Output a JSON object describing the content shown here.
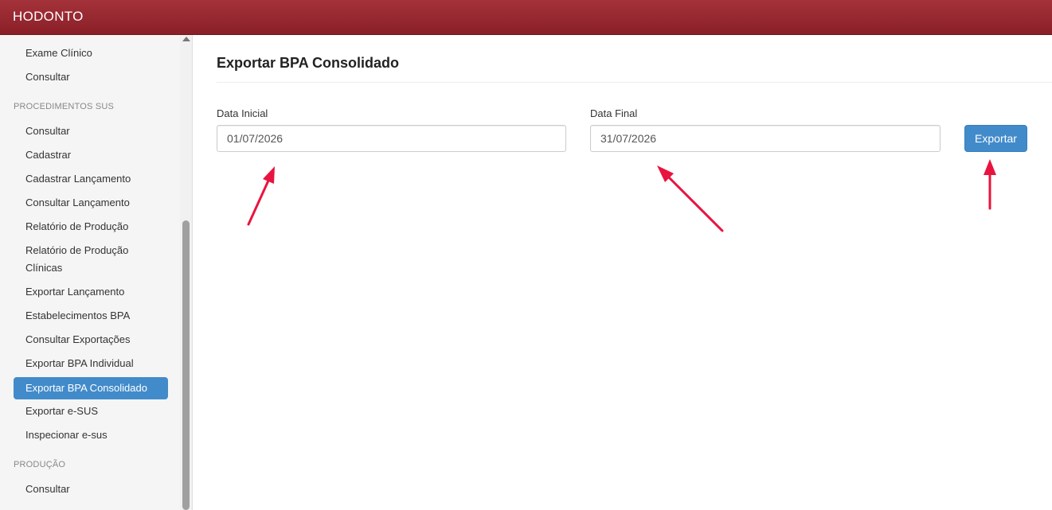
{
  "app": {
    "title": "HODONTO"
  },
  "sidebar": {
    "items": [
      {
        "label": "Exame Clínico"
      },
      {
        "label": "Consultar"
      }
    ],
    "sections": [
      {
        "header": "PROCEDIMENTOS SUS",
        "items": [
          {
            "label": "Consultar"
          },
          {
            "label": "Cadastrar"
          },
          {
            "label": "Cadastrar Lançamento"
          },
          {
            "label": "Consultar Lançamento"
          },
          {
            "label": "Relatório de Produção"
          },
          {
            "label": "Relatório de Produção"
          },
          {
            "label": "Clínicas"
          },
          {
            "label": "Exportar Lançamento"
          },
          {
            "label": "Estabelecimentos BPA"
          },
          {
            "label": "Consultar Exportações"
          },
          {
            "label": "Exportar BPA Individual"
          },
          {
            "label": "Exportar BPA Consolidado",
            "active": true
          },
          {
            "label": "Exportar e-SUS"
          },
          {
            "label": "Inspecionar e-sus"
          }
        ]
      },
      {
        "header": "PRODUÇÃO",
        "items": [
          {
            "label": "Consultar"
          }
        ]
      }
    ]
  },
  "main": {
    "title": "Exportar BPA Consolidado",
    "start_date": {
      "label": "Data Inicial",
      "value": "01/07/2026"
    },
    "end_date": {
      "label": "Data Final",
      "value": "31/07/2026"
    },
    "export_button": {
      "label": "Exportar"
    }
  },
  "colors": {
    "header_red": "#8f232b",
    "accent_blue": "#428bca",
    "annotation_arrow": "#e8143f"
  }
}
